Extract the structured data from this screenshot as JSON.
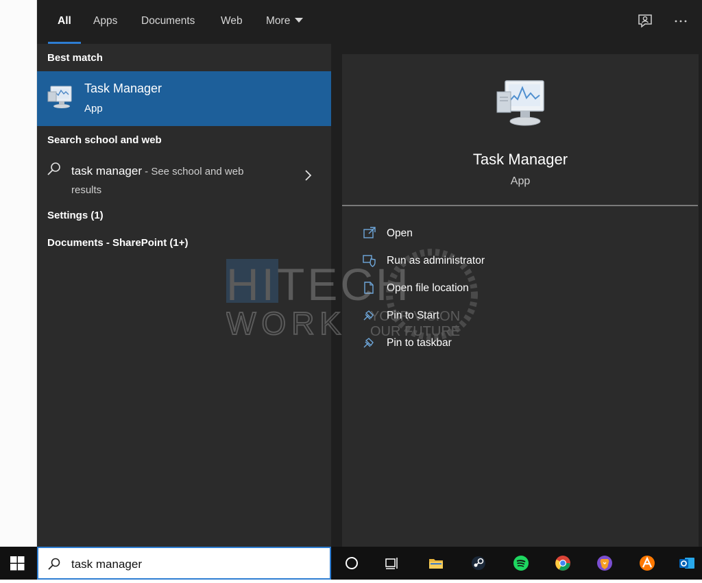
{
  "tabs": [
    {
      "label": "All",
      "active": true
    },
    {
      "label": "Apps"
    },
    {
      "label": "Documents"
    },
    {
      "label": "Web"
    },
    {
      "label": "More"
    }
  ],
  "top_icons": [
    "feedback-icon",
    "more-options-icon"
  ],
  "left": {
    "best_match_heading": "Best match",
    "best_match": {
      "title": "Task Manager",
      "subtitle": "App",
      "icon": "task-manager-icon"
    },
    "web_heading": "Search school and web",
    "web_item": {
      "query": "task manager",
      "suffix": " - See school and web",
      "suffix2": "results"
    },
    "settings_heading": "Settings (1)",
    "documents_heading": "Documents - SharePoint (1+)"
  },
  "detail": {
    "title": "Task Manager",
    "subtitle": "App",
    "actions": [
      {
        "label": "Open",
        "icon": "open-icon"
      },
      {
        "label": "Run as administrator",
        "icon": "shield-icon"
      },
      {
        "label": "Open file location",
        "icon": "folder-icon"
      },
      {
        "label": "Pin to Start",
        "icon": "pin-icon"
      },
      {
        "label": "Pin to taskbar",
        "icon": "pin-icon"
      }
    ]
  },
  "watermark": {
    "line1": "HITECH",
    "line2": "WORK",
    "tag1": "YOUR VISION",
    "tag2": "OUR FUTURE"
  },
  "taskbar": {
    "search_value": "task manager",
    "apps": [
      "cortana",
      "task-view",
      "file-explorer",
      "steam",
      "spotify",
      "chrome",
      "brave",
      "avast",
      "outlook"
    ]
  },
  "colors": {
    "accent": "#2d7dd2",
    "selected": "#1d5f9a",
    "pane": "#2b2b2b"
  }
}
